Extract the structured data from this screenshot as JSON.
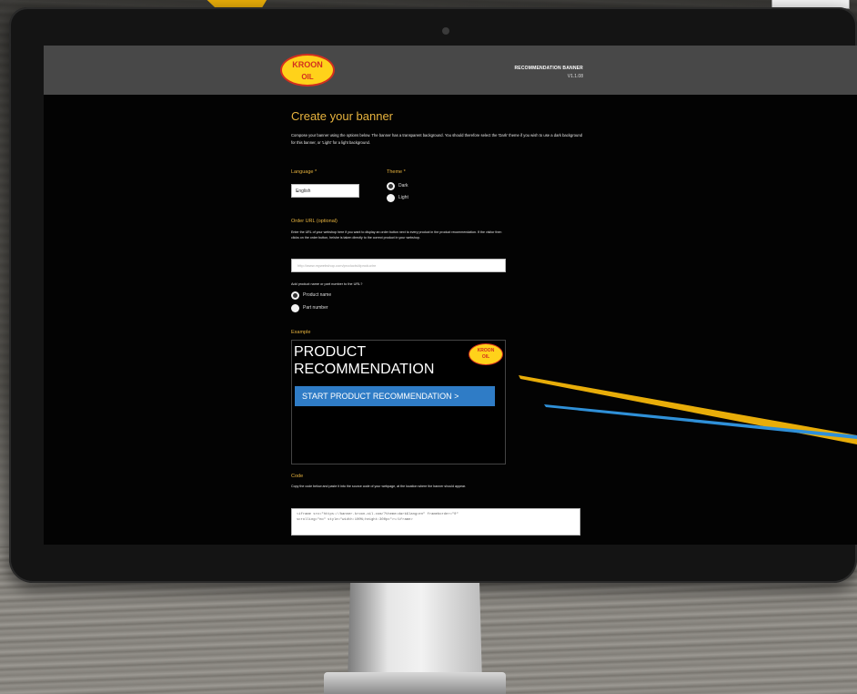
{
  "header": {
    "logo_line1": "KROON",
    "logo_line2": "OIL",
    "title": "RECOMMENDATION BANNER",
    "version": "V1.1.08"
  },
  "form": {
    "heading": "Create your banner",
    "intro": "Compose your banner using the options below. The banner has a transparent background. You should therefore select the 'Dark' theme if you wish to use a dark background for this banner, or 'Light' for a light background.",
    "language_label": "Language *",
    "language_value": "English",
    "theme_label": "Theme *",
    "theme_options": [
      "Dark",
      "Light"
    ],
    "theme_selected": "Dark",
    "order_url_label": "Order URL (optional)",
    "order_url_help": "Enter the URL of your webshop here if you want to display an order button next to every product in the product recommendation. If the visitor then clicks on the order button, he/she is taken directly to the correct product in your webshop.",
    "order_url_placeholder": "http://www.mywebshop.com/products/#productnr",
    "add_label": "Add product name or part number to the URL?",
    "add_options": [
      "Product name",
      "Part number"
    ],
    "add_selected": "Product name"
  },
  "example": {
    "label": "Example",
    "title_line1": "PRODUCT",
    "title_line2": "RECOMMENDATION",
    "button_label": "START PRODUCT RECOMMENDATION  >"
  },
  "code": {
    "label": "Code",
    "help": "Copy the code below and paste it into the source code of your webpage, at the location where the banner should appear.",
    "line1": "<iframe src=\"https://banner.kroon-oil.com/?theme=dark&lang=en\" frameborder=\"0\"",
    "line2": "scrolling=\"no\" style=\"width:100%;height:300px\"></iframe>"
  },
  "colors": {
    "accent": "#e7b33e",
    "button_blue": "#2f7cc6",
    "brand_yellow": "#ffd21a",
    "brand_red": "#d32f1f"
  }
}
